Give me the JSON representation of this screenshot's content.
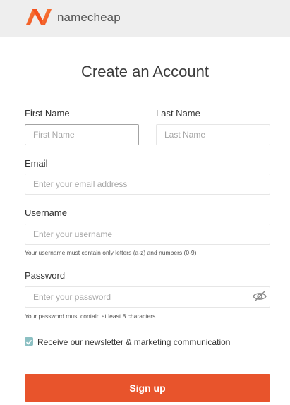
{
  "header": {
    "brand_name": "namecheap",
    "logo_icon": "namecheap-logo-icon",
    "brand_color": "#f4511e"
  },
  "form": {
    "title": "Create an Account",
    "first_name": {
      "label": "First Name",
      "placeholder": "First Name",
      "value": ""
    },
    "last_name": {
      "label": "Last Name",
      "placeholder": "Last Name",
      "value": ""
    },
    "email": {
      "label": "Email",
      "placeholder": "Enter your email address",
      "value": ""
    },
    "username": {
      "label": "Username",
      "placeholder": "Enter your username",
      "value": "",
      "hint": "Your username must contain only letters (a-z) and numbers (0-9)"
    },
    "password": {
      "label": "Password",
      "placeholder": "Enter your password",
      "value": "",
      "hint": "Your password must contain at least 8 characters",
      "toggle_icon": "eye-slash-icon"
    },
    "newsletter": {
      "label": "Receive our newsletter & marketing communication",
      "checked": true
    },
    "submit_label": "Sign up",
    "accent_color": "#e8542c"
  }
}
